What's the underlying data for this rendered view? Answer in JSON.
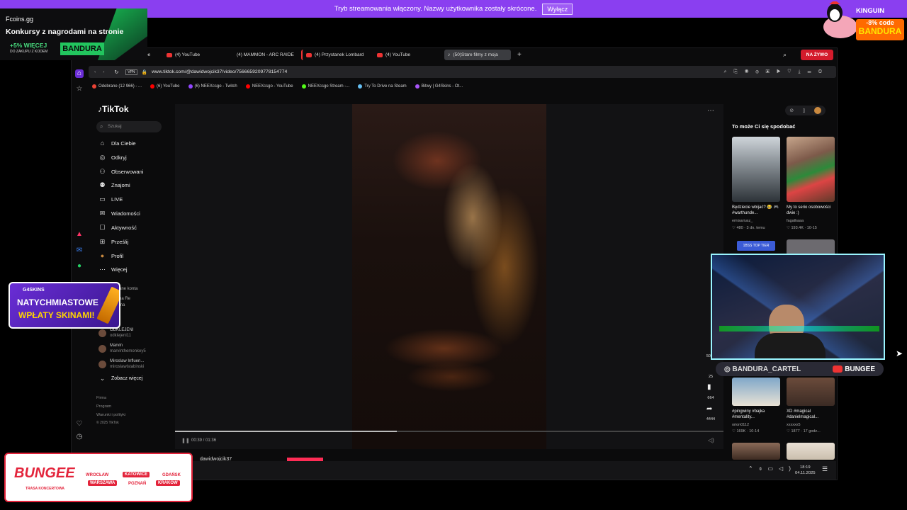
{
  "stream_banner": {
    "message": "Tryb streamowania włączony. Nazwy użytkownika zostały skrócone.",
    "button": "Wyłącz"
  },
  "fcoins_ad": {
    "brand": "Fcoins.gg",
    "headline": "Konkursy z nagrodami na stronie",
    "bonus": "+5% WIĘCEJ",
    "bonus_sub": "DO ZAKUPU Z KODEM",
    "code": "BANDURA"
  },
  "kinguin_ad": {
    "brand": "KINGUIN",
    "discount": "-8% code",
    "code": "BANDURA"
  },
  "browser": {
    "tabs": [
      "be",
      "(4) YouTube",
      "(4) MAMMON - ARC RAIDE",
      "(4) Przystanek Lombard",
      "(4) YouTube",
      "(50)Stare filmy z moja"
    ],
    "live_label": "NA ŻYWO",
    "url": "www.tiktok.com/@dawidwojcik37/video/7566659209778154774",
    "vpn": "VPN",
    "bookmarks": [
      "Odebrane (12 966) - ...",
      "(6) YouTube",
      "(6) NEEXcsgo - Twitch",
      "NEEXcsgo - YouTube",
      "NEEXcsgo Stream -...",
      "Try To Drive na Steam",
      "Bitwy | G4Skins - Ot..."
    ]
  },
  "tiktok": {
    "logo": "TikTok",
    "search_placeholder": "Szukaj",
    "nav": [
      {
        "icon": "home-icon",
        "label": "Dla Ciebie"
      },
      {
        "icon": "compass-icon",
        "label": "Odkryj"
      },
      {
        "icon": "following-icon",
        "label": "Obserwowani"
      },
      {
        "icon": "friends-icon",
        "label": "Znajomi"
      },
      {
        "icon": "live-icon",
        "label": "LIVE"
      },
      {
        "icon": "messages-icon",
        "label": "Wiadomości"
      },
      {
        "icon": "activity-icon",
        "label": "Aktywność"
      },
      {
        "icon": "upload-icon",
        "label": "Prześlij"
      },
      {
        "icon": "profile-icon",
        "label": "Profil"
      },
      {
        "icon": "more-icon",
        "label": "Więcej"
      }
    ],
    "following_partial": [
      "ane konta",
      "na Re",
      "ma"
    ],
    "suggested": [
      {
        "name": "ODKLEJENI",
        "handle": "odklejeni11"
      },
      {
        "name": "Marvin",
        "handle": "marvinthemonkey5"
      },
      {
        "name": "Miroslaw Influen...",
        "handle": "miroslawistabinski"
      }
    ],
    "see_more": "Zobacz więcej",
    "footer": [
      "Firma",
      "Program",
      "Warunki i polityki",
      "© 2025 TikTok"
    ],
    "video": {
      "time": "00:39 / 01:36",
      "progress": 0.4,
      "author": "dawidwojcik37"
    },
    "actions": {
      "likes": "5041",
      "comments": "25",
      "saves": "664",
      "shares": "4444"
    },
    "recommended_title": "To może Ci się spodobać",
    "recommended": [
      {
        "caption": "Będziecie wbijać? 😂 🎮 #warthunde...",
        "author": "emisariusz_",
        "views": "480",
        "age": "3 dn. temu"
      },
      {
        "caption": "My to serio osobowości dwie :)",
        "author": "fagatkaaa",
        "views": "193.4K",
        "age": "10-15"
      },
      {
        "caption": "#pingwiny #bajka #mentality...",
        "author": "orion0112",
        "views": "169K",
        "age": "10-14"
      },
      {
        "caption": "XD #magical #danielmagical...",
        "author": "xxxxxx5",
        "views": "1877",
        "age": "17 godz..."
      }
    ],
    "top_tier_label": "1BSS TOP TIER"
  },
  "taskbar": {
    "time": "18:19",
    "date": "04.11.2025"
  },
  "webcam_social": {
    "instagram": "BANDURA_CARTEL",
    "youtube": "BUNGEE"
  },
  "g4skins_ad": {
    "brand": "G4SKINS",
    "line1": "NATYCHMIASTOWE",
    "line2": "WPŁATY SKINAMI!"
  },
  "bungee_ad": {
    "title": "BUNGEE",
    "subtitle": "TRASA KONCERTOWA",
    "cities": [
      "WROCŁAW",
      "KATOWICE",
      "GDAŃSK",
      "WARSZAWA",
      "POZNAŃ",
      "KRAKÓW"
    ]
  },
  "colors": {
    "twitch_purple": "#8a3ff0",
    "tiktok_red": "#fe2c55",
    "bungee_red": "#e3243b"
  }
}
